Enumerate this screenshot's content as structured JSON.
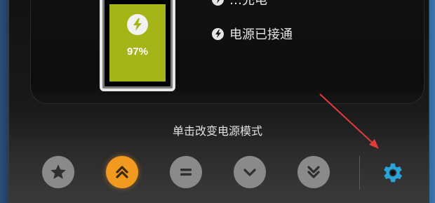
{
  "battery": {
    "percent_label": "97%",
    "charge_level": 0.97,
    "fill_color": "#a5b416"
  },
  "status": [
    {
      "icon": "bolt-icon",
      "label": "…充电"
    },
    {
      "icon": "bolt-icon",
      "label": "电源已接通"
    }
  ],
  "mode_section": {
    "label": "单击改变电源模式",
    "buttons": [
      {
        "icon": "star-icon",
        "active": false
      },
      {
        "icon": "double-chevron-up-icon",
        "active": true
      },
      {
        "icon": "equals-icon",
        "active": false
      },
      {
        "icon": "chevron-down-icon",
        "active": false
      },
      {
        "icon": "double-chevron-down-icon",
        "active": false
      }
    ],
    "active_color": "#f29a1f",
    "inactive_color": "#8a8a8a"
  },
  "settings": {
    "icon": "gear-icon",
    "color": "#2aa3d8"
  },
  "annotation": {
    "arrow_color": "#e23b3b"
  }
}
